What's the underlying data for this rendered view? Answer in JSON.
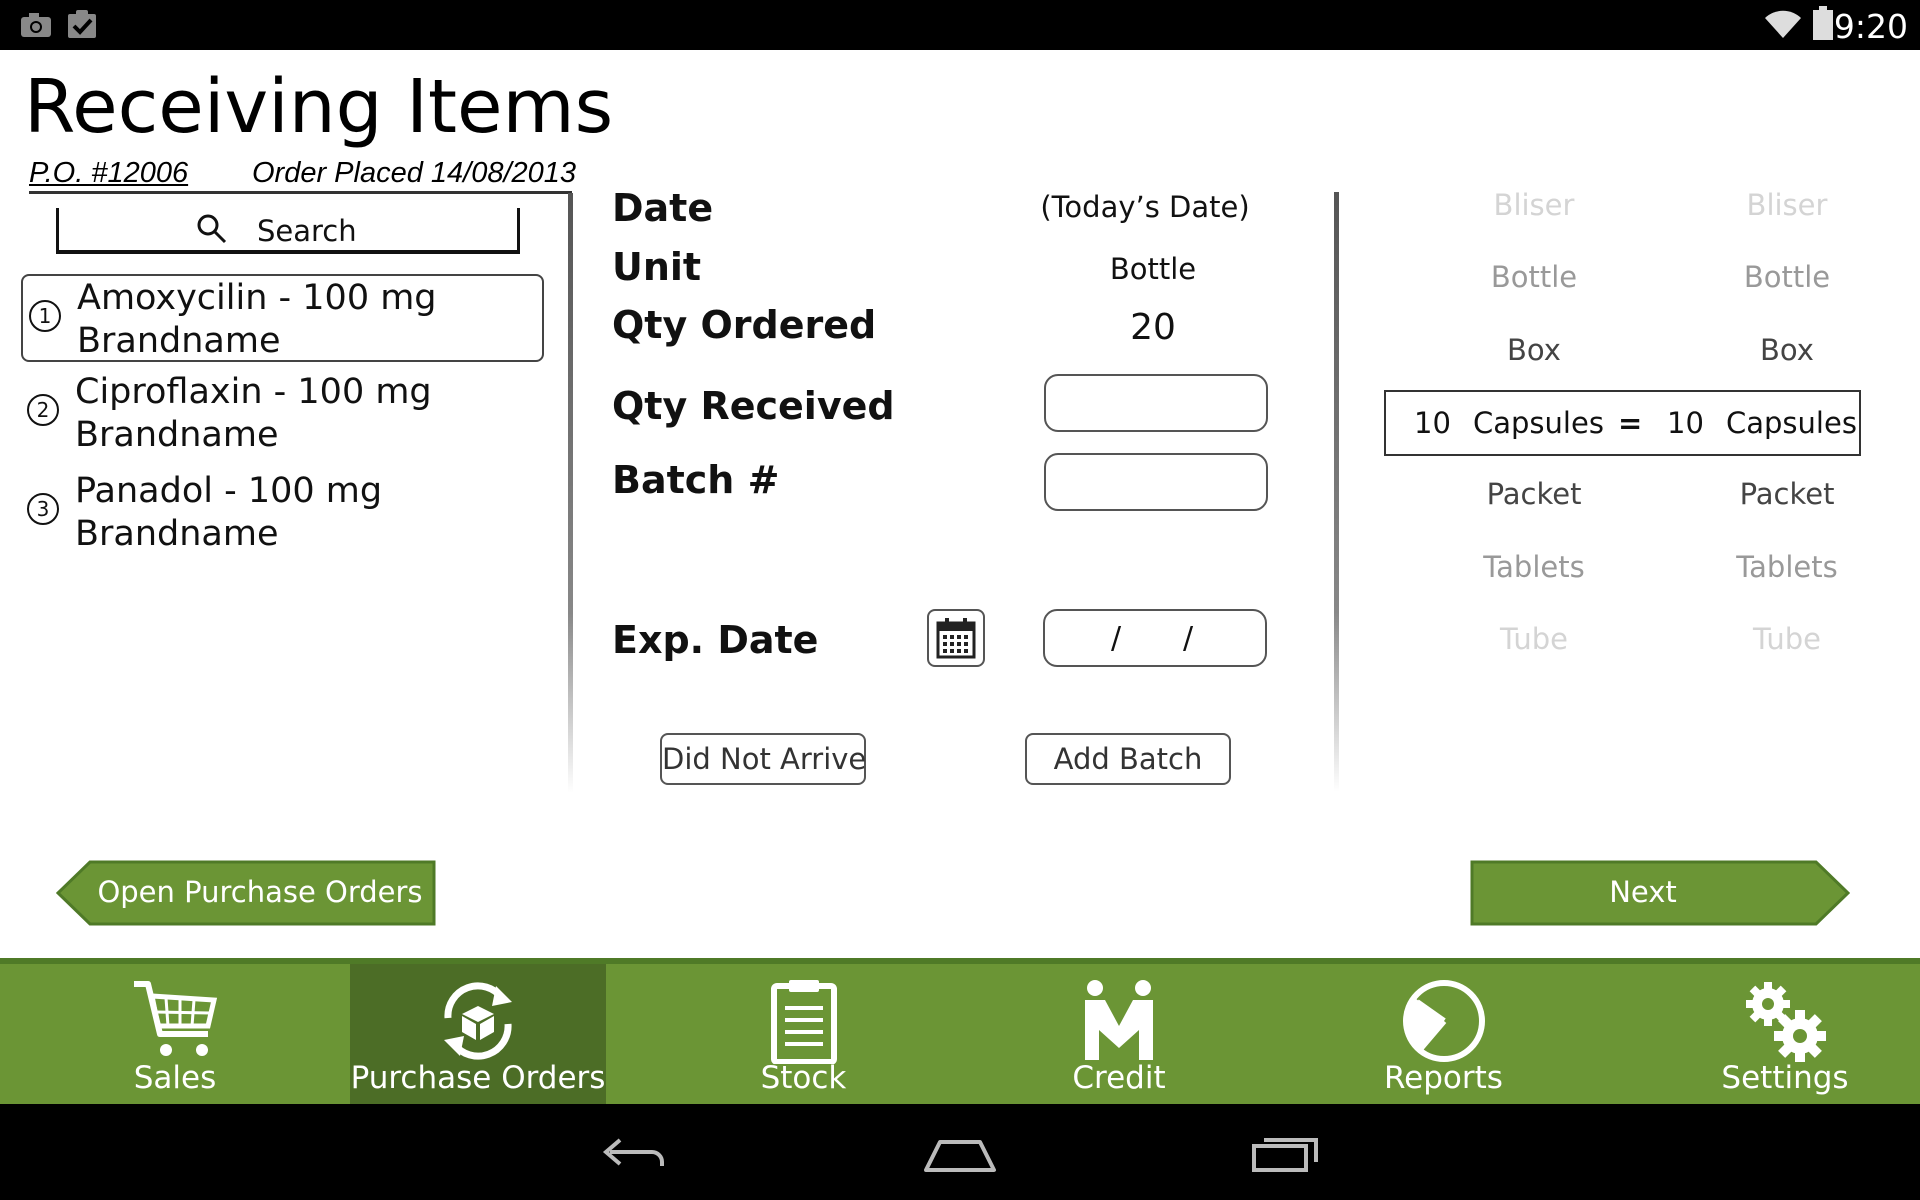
{
  "status_bar": {
    "time": "9:20",
    "icons": [
      "camera-icon",
      "clipboard-check-icon",
      "wifi-icon",
      "battery-icon"
    ]
  },
  "page": {
    "title": "Receiving Items",
    "po_number": "P.O. #12006",
    "order_placed": "Order Placed 14/08/2013"
  },
  "search": {
    "label": "Search"
  },
  "items": [
    {
      "number": "1",
      "name": "Amoxycilin - 100 mg",
      "brand": "Brandname",
      "selected": true
    },
    {
      "number": "2",
      "name": "Ciproflaxin - 100 mg",
      "brand": "Brandname",
      "selected": false
    },
    {
      "number": "3",
      "name": "Panadol - 100 mg",
      "brand": "Brandname",
      "selected": false
    }
  ],
  "form": {
    "date_label": "Date",
    "date_value": "(Today’s Date)",
    "unit_label": "Unit",
    "unit_value": "Bottle",
    "qty_ordered_label": "Qty Ordered",
    "qty_ordered_value": "20",
    "qty_received_label": "Qty Received",
    "qty_received_value": "",
    "batch_label": "Batch #",
    "batch_value": "",
    "exp_date_label": "Exp. Date",
    "exp_date_sep1": "/",
    "exp_date_sep2": "/",
    "did_not_arrive": "Did Not Arrive",
    "add_batch": "Add Batch"
  },
  "unit_picker": {
    "left": [
      "Bliser",
      "Bottle",
      "Box",
      "Packet",
      "Tablets",
      "Tube"
    ],
    "right": [
      "Bliser",
      "Bottle",
      "Box",
      "Packet",
      "Tablets",
      "Tube"
    ],
    "conversion": {
      "left_qty": "10",
      "left_unit": "Capsules",
      "equals": "=",
      "right_qty": "10",
      "right_unit": "Capsules"
    }
  },
  "nav_buttons": {
    "back": "Open Purchase Orders",
    "next": "Next"
  },
  "tabs": [
    {
      "label": "Sales",
      "icon": "cart-icon",
      "active": false
    },
    {
      "label": "Purchase Orders",
      "icon": "purchase-orders-icon",
      "active": true
    },
    {
      "label": "Stock",
      "icon": "clipboard-icon",
      "active": false
    },
    {
      "label": "Credit",
      "icon": "handshake-icon",
      "active": false
    },
    {
      "label": "Reports",
      "icon": "pie-chart-icon",
      "active": false
    },
    {
      "label": "Settings",
      "icon": "gears-icon",
      "active": false
    }
  ],
  "colors": {
    "accent_green": "#6b9535",
    "active_tab": "#4c6d26",
    "faded_unit": "#c8c8c8",
    "mid_unit": "#777777"
  }
}
